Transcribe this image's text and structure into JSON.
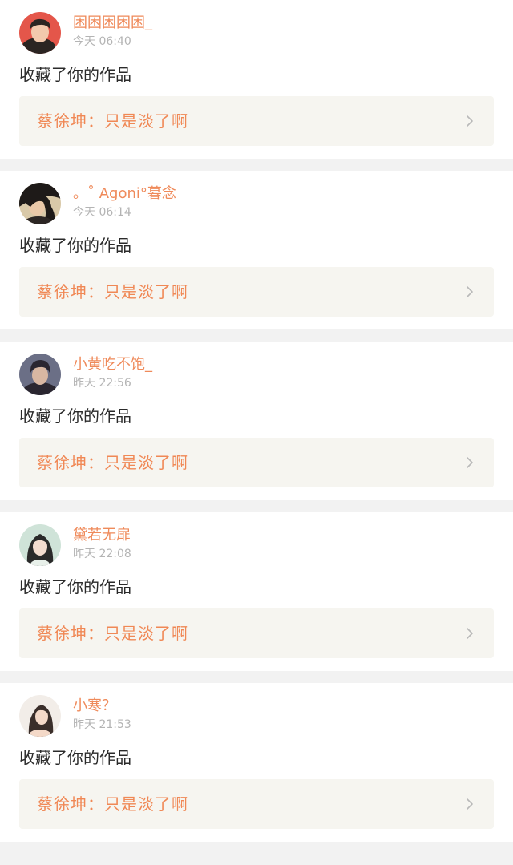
{
  "notifications": [
    {
      "username": "困困困困困_",
      "timestamp": "今天 06:40",
      "action": "收藏了你的作品",
      "work": "蔡徐坤：只是淡了啊",
      "avatar_icon": "user-avatar-photo",
      "avatar_colors": [
        "#e4564a",
        "#2b2522",
        "#f2c9ad"
      ]
    },
    {
      "username": "。˚ Agoni°暮念",
      "timestamp": "今天 06:14",
      "action": "收藏了你的作品",
      "work": "蔡徐坤：只是淡了啊",
      "avatar_icon": "user-avatar-photo",
      "avatar_colors": [
        "#d9c9a8",
        "#1e1a18",
        "#e9c8a8"
      ]
    },
    {
      "username": "小黄吃不饱_",
      "timestamp": "昨天 22:56",
      "action": "收藏了你的作品",
      "work": "蔡徐坤：只是淡了啊",
      "avatar_icon": "user-avatar-photo",
      "avatar_colors": [
        "#6b6f86",
        "#2a2630",
        "#d8b7a2"
      ]
    },
    {
      "username": "黛若无扉",
      "timestamp": "昨天 22:08",
      "action": "收藏了你的作品",
      "work": "蔡徐坤：只是淡了啊",
      "avatar_icon": "user-avatar-photo",
      "avatar_colors": [
        "#cfe3d8",
        "#2a2a2a",
        "#f3dccf"
      ]
    },
    {
      "username": "小寒？",
      "timestamp": "昨天 21:53",
      "action": "收藏了你的作品",
      "work": "蔡徐坤：只是淡了啊",
      "avatar_icon": "user-avatar-photo",
      "avatar_colors": [
        "#f2ede8",
        "#3a2e2a",
        "#f4d9c8"
      ]
    }
  ],
  "colors": {
    "username": "#ef8a5a",
    "work_title": "#f08855",
    "work_background": "#f6f5f0",
    "separator": "#f2f2f2",
    "timestamp": "#b4b4b4",
    "action_text": "#2b2b2b"
  },
  "chevron_icon": "chevron-right-icon"
}
